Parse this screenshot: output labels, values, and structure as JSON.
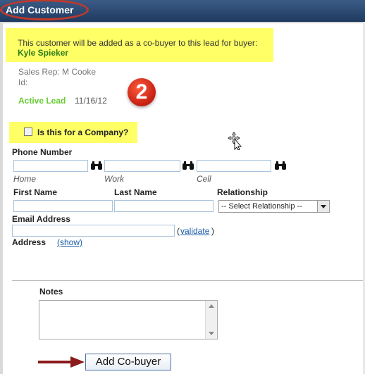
{
  "dialog": {
    "title": "Add Customer"
  },
  "notice": {
    "message": "This customer will be added as a co-buyer to this lead for buyer:",
    "buyer_name": "Kyle Spieker"
  },
  "lead": {
    "sales_rep": "Sales Rep: M Cooke",
    "id_label": "Id:",
    "status": "Active Lead",
    "date": "11/16/12"
  },
  "badge": {
    "number": "2"
  },
  "company": {
    "label": "Is this for a Company?",
    "checked": false
  },
  "phone": {
    "section_label": "Phone Number",
    "home_label": "Home",
    "work_label": "Work",
    "cell_label": "Cell",
    "home_value": "",
    "work_value": "",
    "cell_value": ""
  },
  "name": {
    "first_label": "First Name",
    "last_label": "Last Name",
    "relationship_label": "Relationship",
    "first_value": "",
    "last_value": "",
    "relationship_selected": "-- Select Relationship --"
  },
  "email": {
    "label": "Email Address",
    "value": "",
    "paren_open": "(",
    "validate_link": "validate",
    "paren_close": ")"
  },
  "address": {
    "label": "Address",
    "show_link": "(show)"
  },
  "notes": {
    "label": "Notes",
    "value": ""
  },
  "actions": {
    "submit_label": "Add Co-buyer"
  },
  "colors": {
    "titlebar": "#2b4a73",
    "highlight": "#ffff66",
    "buyer_name": "#2e7d1a",
    "active_lead": "#66cc33",
    "badge": "#d7261a",
    "annotation": "#8b1a1a"
  },
  "icons": {
    "phone_lookup": "binoculars-icon",
    "cursor": "move-cursor-icon",
    "annotation": "arrow-right-icon"
  }
}
